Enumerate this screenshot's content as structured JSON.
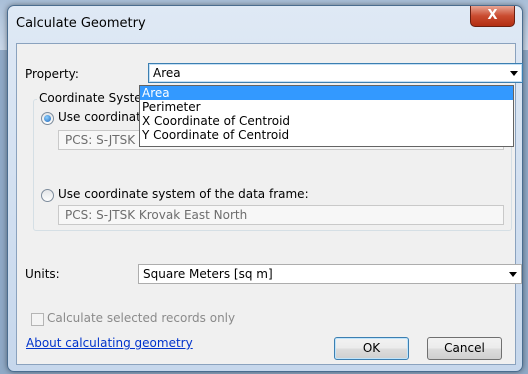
{
  "window": {
    "title": "Calculate Geometry",
    "close_glyph": "X"
  },
  "property": {
    "label": "Property:",
    "selected": "Area",
    "options": [
      "Area",
      "Perimeter",
      "X Coordinate of Centroid",
      "Y Coordinate of Centroid"
    ]
  },
  "coordinate_system": {
    "group_title": "Coordinate System",
    "option_source_label": "Use coordinate system of the data source:",
    "option_source_value": "PCS: S-JTSK Krovak East North",
    "option_frame_label": "Use coordinate system of the data frame:",
    "option_frame_value": "PCS: S-JTSK Krovak East North"
  },
  "units": {
    "label": "Units:",
    "selected": "Square Meters [sq m]"
  },
  "selected_only": {
    "label": "Calculate selected records only"
  },
  "help_link": "About calculating geometry",
  "buttons": {
    "ok": "OK",
    "cancel": "Cancel"
  }
}
